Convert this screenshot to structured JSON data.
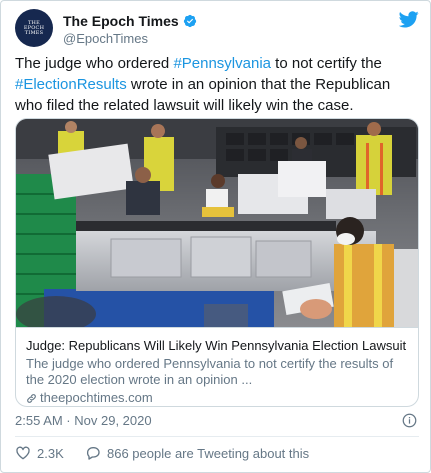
{
  "account": {
    "display_name": "The Epoch Times",
    "handle": "@EpochTimes",
    "avatar_text": [
      "THE",
      "EPOCH",
      "TIMES"
    ],
    "verified": true
  },
  "tweet": {
    "segments": [
      {
        "text": "The judge who ordered ",
        "type": "text"
      },
      {
        "text": "#Pennsylvania",
        "type": "hashtag"
      },
      {
        "text": " to not certify the ",
        "type": "text"
      },
      {
        "text": "#ElectionResults",
        "type": "hashtag"
      },
      {
        "text": " wrote in an opinion that the Republican who filed the related lawsuit will likely win the case.",
        "type": "text"
      }
    ]
  },
  "card": {
    "title": "Judge: Republicans Will Likely Win Pennsylvania Election Lawsuit",
    "description": "The judge who ordered Pennsylvania to not certify the results of the 2020 election wrote in an opinion ...",
    "domain": "theepochtimes.com",
    "image_icon": "photo-of-election-workers-counting-ballots"
  },
  "meta": {
    "timestamp": "2:55 AM · Nov 29, 2020"
  },
  "actions": {
    "likes": "2.3K",
    "conversation": "866 people are Tweeting about this"
  },
  "colors": {
    "accent": "#1b95e0",
    "twitter_blue": "#1da1f2",
    "secondary_text": "#657786",
    "border": "#cfd9de",
    "like_red": "#e0245e"
  }
}
